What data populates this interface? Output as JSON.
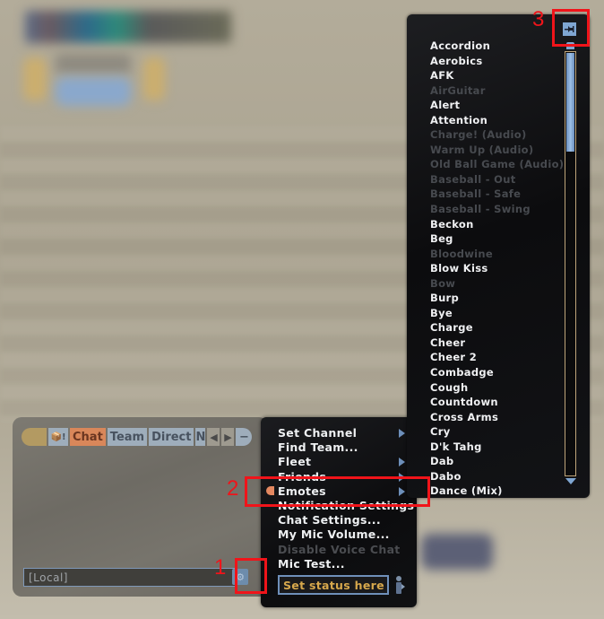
{
  "chat_window": {
    "tabs": [
      {
        "label": ""
      },
      {
        "label": "📦!"
      },
      {
        "label": "Chat",
        "active": true
      },
      {
        "label": "Team"
      },
      {
        "label": "Direct"
      },
      {
        "label": "N"
      }
    ],
    "nav_prev": "◀",
    "nav_next": "▶",
    "minimize": "−",
    "input_value": "[Local]",
    "settings_icon": "gear-chat-icon"
  },
  "context_menu": {
    "items": [
      {
        "label": "Set Channel",
        "submenu": true,
        "disabled": false
      },
      {
        "label": "Find Team...",
        "submenu": false,
        "disabled": false
      },
      {
        "label": "Fleet",
        "submenu": true,
        "disabled": false
      },
      {
        "label": "Friends",
        "submenu": true,
        "disabled": false
      },
      {
        "label": "Emotes",
        "submenu": true,
        "disabled": false,
        "highlighted": true
      },
      {
        "label": "Notification Settings",
        "submenu": false,
        "disabled": false
      },
      {
        "label": "Chat Settings...",
        "submenu": false,
        "disabled": false
      },
      {
        "label": "My Mic Volume...",
        "submenu": false,
        "disabled": false
      },
      {
        "label": "Disable Voice Chat",
        "submenu": false,
        "disabled": true
      },
      {
        "label": "Mic Test...",
        "submenu": false,
        "disabled": false
      }
    ],
    "status_placeholder": "Set status here."
  },
  "emote_panel": {
    "items": [
      {
        "label": "Accordion",
        "disabled": false
      },
      {
        "label": "Aerobics",
        "disabled": false
      },
      {
        "label": "AFK",
        "disabled": false
      },
      {
        "label": "AirGuitar",
        "disabled": true
      },
      {
        "label": "Alert",
        "disabled": false
      },
      {
        "label": "Attention",
        "disabled": false
      },
      {
        "label": "Charge! (Audio)",
        "disabled": true
      },
      {
        "label": "Warm Up (Audio)",
        "disabled": true
      },
      {
        "label": "Old Ball Game (Audio)",
        "disabled": true
      },
      {
        "label": "Baseball - Out",
        "disabled": true
      },
      {
        "label": "Baseball - Safe",
        "disabled": true
      },
      {
        "label": "Baseball - Swing",
        "disabled": true
      },
      {
        "label": "Beckon",
        "disabled": false
      },
      {
        "label": "Beg",
        "disabled": false
      },
      {
        "label": "Bloodwine",
        "disabled": true
      },
      {
        "label": "Blow Kiss",
        "disabled": false
      },
      {
        "label": "Bow",
        "disabled": true
      },
      {
        "label": "Burp",
        "disabled": false
      },
      {
        "label": "Bye",
        "disabled": false
      },
      {
        "label": "Charge",
        "disabled": false
      },
      {
        "label": "Cheer",
        "disabled": false
      },
      {
        "label": "Cheer 2",
        "disabled": false
      },
      {
        "label": "Combadge",
        "disabled": false
      },
      {
        "label": "Cough",
        "disabled": false
      },
      {
        "label": "Countdown",
        "disabled": false
      },
      {
        "label": "Cross Arms",
        "disabled": false
      },
      {
        "label": "Cry",
        "disabled": false
      },
      {
        "label": "D'k Tahg",
        "disabled": false
      },
      {
        "label": "Dab",
        "disabled": false
      },
      {
        "label": "Dabo",
        "disabled": false
      },
      {
        "label": "Dance (Mix)",
        "disabled": false
      }
    ],
    "scroll_position": 0.0
  },
  "annotations": [
    {
      "number": "1"
    },
    {
      "number": "2"
    },
    {
      "number": "3"
    }
  ],
  "colors": {
    "annotation_red": "#f0141a",
    "accent_blue": "#7fa6d2",
    "active_tab_orange": "#d9875a",
    "status_text_gold": "#d7a84c"
  }
}
